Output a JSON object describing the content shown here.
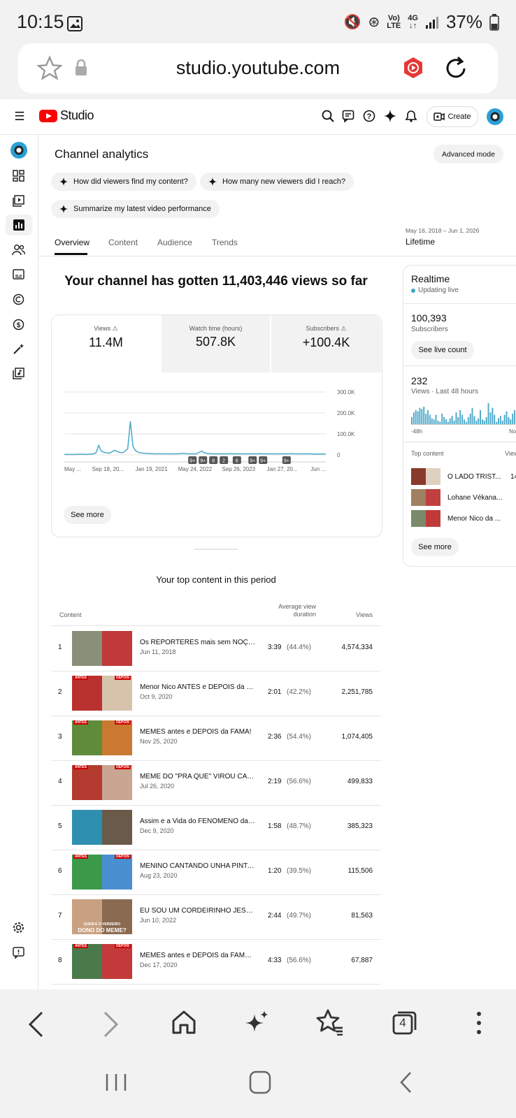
{
  "status": {
    "time": "10:15",
    "network_top": "Vo)",
    "network_bottom": "LTE",
    "gen_top": "4G",
    "gen_bottom": "↓↑",
    "battery": "37%"
  },
  "browser": {
    "url": "studio.youtube.com"
  },
  "header": {
    "brand": "Studio",
    "create_label": "Create"
  },
  "page": {
    "title": "Channel analytics",
    "advanced_label": "Advanced mode",
    "chips": [
      "How did viewers find my content?",
      "How many new viewers did I reach?",
      "Summarize my latest video performance"
    ],
    "tabs": [
      "Overview",
      "Content",
      "Audience",
      "Trends"
    ],
    "active_tab": "Overview",
    "date_range": "May 16, 2018 – Jun 1, 2026",
    "period": "Lifetime",
    "headline": "Your channel has gotten 11,403,446 views so far"
  },
  "metrics": [
    {
      "label": "Views",
      "value": "11.4M",
      "warning": true
    },
    {
      "label": "Watch time (hours)",
      "value": "507.8K",
      "warning": false
    },
    {
      "label": "Subscribers",
      "value": "+100.4K",
      "warning": true
    }
  ],
  "chart_data": {
    "type": "line",
    "series": [
      {
        "values": [
          2,
          2,
          2,
          2,
          2,
          3,
          3,
          3,
          2,
          3,
          4,
          5,
          10,
          45,
          18,
          12,
          10,
          8,
          14,
          22,
          16,
          12,
          10,
          18,
          30,
          160,
          40,
          20,
          12,
          9,
          8,
          7,
          6,
          6,
          5,
          5,
          6,
          5,
          5,
          5,
          5,
          5,
          5,
          5,
          6,
          7,
          6,
          5,
          5,
          5,
          5,
          12,
          18,
          10,
          7,
          6,
          5,
          5,
          5,
          5,
          5,
          5,
          5,
          6,
          5,
          5,
          5,
          5,
          5,
          5,
          5,
          5,
          5,
          5,
          6,
          5,
          5,
          5,
          5,
          5,
          5,
          5,
          5,
          5,
          5,
          5,
          6,
          5,
          5,
          5,
          5,
          5,
          5,
          5,
          4,
          4,
          4,
          4,
          4,
          4
        ]
      }
    ],
    "x_tick_labels": [
      "May ...",
      "Sep 18, 20...",
      "Jan 19, 2021",
      "May 24, 2022",
      "Sep 26, 2023",
      "Jan 27, 20...",
      "Jun ..."
    ],
    "y_tick_labels": [
      "300.0K",
      "200.0K",
      "100.0K",
      "0"
    ],
    "ylim": [
      0,
      300
    ],
    "annotations": [
      "9+",
      "9+",
      "8",
      "2",
      "6",
      "9+",
      "9+",
      "9+"
    ],
    "color": "#4aa8c9"
  },
  "chart_footer": {
    "see_more": "See more"
  },
  "top_content": {
    "title": "Your top content in this period",
    "col_content": "Content",
    "col_avg_1": "Average view",
    "col_avg_2": "duration",
    "col_views": "Views",
    "rows": [
      {
        "rank": "1",
        "title": "Os REPÓRTERES mais sem NOÇÃO ...",
        "date": "Jun 11, 2018",
        "duration": "3:39",
        "pct": "(44.4%)",
        "views": "4,574,334",
        "c1": "#8a8f7a",
        "c2": "#c03a3a"
      },
      {
        "rank": "2",
        "title": "Menor Nico ANTES e DEPOIS da FA...",
        "date": "Oct 9, 2020",
        "duration": "2:01",
        "pct": "(42.2%)",
        "views": "2,251,785",
        "c1": "#b8312f",
        "c2": "#d7c3ab"
      },
      {
        "rank": "3",
        "title": "MEMES antes e DEPOIS da FAMA!",
        "date": "Nov 25, 2020",
        "duration": "2:36",
        "pct": "(54.4%)",
        "views": "1,074,405",
        "c1": "#5f8b3a",
        "c2": "#c97a30"
      },
      {
        "rank": "4",
        "title": "MEME DO \"PRA QUE\" VIROU CANT...",
        "date": "Jul 26, 2020",
        "duration": "2:19",
        "pct": "(56.6%)",
        "views": "499,833",
        "c1": "#b33a2f",
        "c2": "#c9a592"
      },
      {
        "rank": "5",
        "title": "Assim e a Vida do FENÔMENO da I...",
        "date": "Dec 9, 2020",
        "duration": "1:58",
        "pct": "(48.7%)",
        "views": "385,323",
        "c1": "#2f8fb0",
        "c2": "#6a5a4a"
      },
      {
        "rank": "6",
        "title": "MENINO CANTANDO UNHA PINTA...",
        "date": "Aug 23, 2020",
        "duration": "1:20",
        "pct": "(39.5%)",
        "views": "115,506",
        "c1": "#3a9a4a",
        "c2": "#4a8fd0"
      },
      {
        "rank": "7",
        "title": "EU SOU UM CORDEIRINHO JESUS É...",
        "date": "Jun 10, 2022",
        "duration": "2:44",
        "pct": "(49.7%)",
        "views": "81,563",
        "c1": "#c9a080",
        "c2": "#8a6a50"
      },
      {
        "rank": "8",
        "title": "MEMES antes e DEPOIS da FAMA! ( ...",
        "date": "Dec 17, 2020",
        "duration": "4:33",
        "pct": "(56.6%)",
        "views": "67,887",
        "c1": "#4a7a4a",
        "c2": "#c43a3a"
      }
    ],
    "thumb_texts": {
      "r2_left": "ANTES",
      "r2_right": "DEPOIS",
      "r3_left": "ANTES",
      "r3_right": "DEPOIS",
      "r4_left": "ANTES",
      "r4_right": "DEPOIS",
      "r6_left": "ANTES",
      "r6_right": "DEPOIS",
      "r7_line1": "QUEM É O VERDEIRO",
      "r7_line2": "DONO DO MEME?",
      "r8_left": "ANTES",
      "r8_right": "DEPOIS"
    }
  },
  "realtime": {
    "title": "Realtime",
    "live": "Updating live",
    "subs_value": "100,393",
    "subs_label": "Subscribers",
    "live_btn": "See live count",
    "views_value": "232",
    "views_label": "Views · Last 48 hours",
    "axis_left": "-48h",
    "axis_right": "No",
    "bars": [
      6,
      10,
      12,
      11,
      14,
      13,
      15,
      9,
      12,
      8,
      5,
      4,
      8,
      3,
      2,
      9,
      6,
      4,
      2,
      5,
      7,
      3,
      10,
      6,
      12,
      8,
      4,
      2,
      6,
      9,
      14,
      7,
      3,
      5,
      12,
      4,
      3,
      6,
      18,
      10,
      14,
      8,
      2,
      5,
      7,
      3,
      8,
      11,
      6,
      4,
      9,
      12
    ],
    "top_content_label": "Top content",
    "col_views": "Views",
    "items": [
      {
        "title": "O LADO TRIST...",
        "views": "14",
        "c1": "#8a3a2a",
        "c2": "#e0d0c0"
      },
      {
        "title": "Lohane Vékana...",
        "views": "",
        "c1": "#a08060",
        "c2": "#c04040"
      },
      {
        "title": "Menor Nico da ...",
        "views": "",
        "c1": "#7a8a6a",
        "c2": "#c03a3a"
      }
    ],
    "see_more": "See more"
  }
}
